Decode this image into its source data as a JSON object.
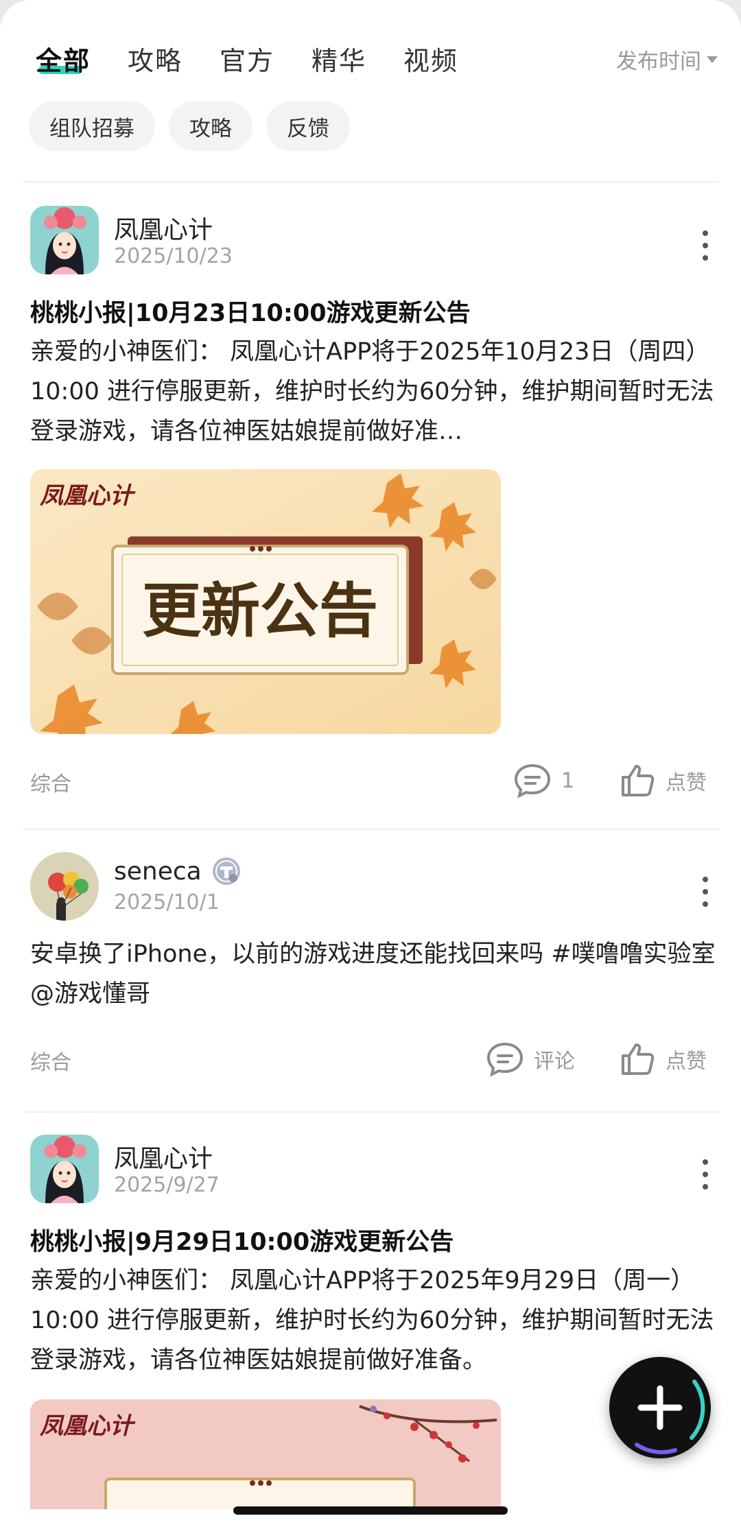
{
  "tabs": [
    {
      "label": "全部",
      "active": true
    },
    {
      "label": "攻略",
      "active": false
    },
    {
      "label": "官方",
      "active": false
    },
    {
      "label": "精华",
      "active": false
    },
    {
      "label": "视频",
      "active": false
    }
  ],
  "sort": {
    "label": "发布时间"
  },
  "chips": [
    "组队招募",
    "攻略",
    "反馈"
  ],
  "posts": [
    {
      "author": "凤凰心计",
      "date": "2025/10/23",
      "title": "桃桃小报|10月23日10:00游戏更新公告",
      "body": "亲爱的小神医们： 凤凰心计APP将于2025年10月23日（周四）10:00 进行停服更新，维护时长约为60分钟，维护期间暂时无法登录游戏，请各位神医姑娘提前做好准…",
      "image_logo": "凤凰心计",
      "image_caption": "更新公告",
      "category": "综合",
      "comment_label": "1",
      "like_label": "点赞"
    },
    {
      "author": "seneca",
      "date": "2025/10/1",
      "body": "安卓换了iPhone，以前的游戏进度还能找回来吗 #噗噜噜实验室 @游戏懂哥",
      "category": "综合",
      "comment_label": "评论",
      "like_label": "点赞"
    },
    {
      "author": "凤凰心计",
      "date": "2025/9/27",
      "title": "桃桃小报|9月29日10:00游戏更新公告",
      "body": "亲爱的小神医们： 凤凰心计APP将于2025年9月29日（周一）10:00 进行停服更新，维护时长约为60分钟，维护期间暂时无法登录游戏，请各位神医姑娘提前做好准备。",
      "image_logo": "凤凰心计"
    }
  ],
  "colors": {
    "accent": "#2dd4bf",
    "muted": "#9a9a9a",
    "chip_bg": "#f2f3f5"
  },
  "icons": {
    "more": "more-vertical-icon",
    "comment": "comment-bubble-icon",
    "like": "thumbs-up-icon",
    "fab": "plus-icon"
  }
}
